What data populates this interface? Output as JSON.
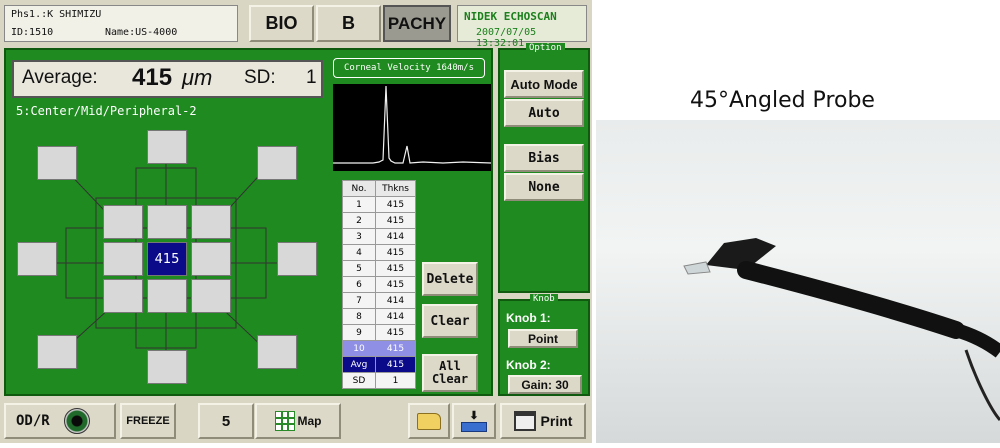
{
  "header": {
    "patient_line": "Phs1.:K SHIMIZU",
    "id_line": "ID:1510",
    "name_line": "Name:US-4000",
    "modes": [
      "BIO",
      "B",
      "PACHY"
    ],
    "brand": "NIDEK ECHOSCAN",
    "datetime": "2007/07/05 13:32:01"
  },
  "measure": {
    "average_label": "Average:",
    "average_value": "415",
    "average_unit": "μm",
    "sd_label": "SD:",
    "sd_value": "1",
    "pattern": "5:Center/Mid/Peripheral-2",
    "corneal_velocity": "Corneal Velocity 1640m/s",
    "center_value": "415"
  },
  "table": {
    "headers": [
      "No.",
      "Thkns"
    ],
    "rows": [
      [
        "1",
        "415"
      ],
      [
        "2",
        "415"
      ],
      [
        "3",
        "414"
      ],
      [
        "4",
        "415"
      ],
      [
        "5",
        "415"
      ],
      [
        "6",
        "415"
      ],
      [
        "7",
        "414"
      ],
      [
        "8",
        "414"
      ],
      [
        "9",
        "415"
      ],
      [
        "10",
        "415"
      ]
    ],
    "avg": [
      "Avg",
      "415"
    ],
    "sd": [
      "SD",
      "1"
    ]
  },
  "actions": {
    "delete": "Delete",
    "clear": "Clear",
    "all_clear_1": "All",
    "all_clear_2": "Clear"
  },
  "option": {
    "title": "Option",
    "auto_mode": "Auto Mode",
    "auto": "Auto",
    "bias": "Bias",
    "none": "None"
  },
  "knob": {
    "title": "Knob",
    "knob1_label": "Knob 1:",
    "knob1_value": "Point",
    "knob2_label": "Knob 2:",
    "knob2_value": "Gain: 30"
  },
  "bottom": {
    "eye": "OD/R",
    "freeze": "FREEZE",
    "count": "5",
    "map": "Map",
    "print": "Print"
  },
  "probe_caption": "45°Angled Probe",
  "colors": {
    "panel_green": "#1f8a1f",
    "selected_blue": "#0b0b8a",
    "brand_green": "#1b7f1b"
  }
}
